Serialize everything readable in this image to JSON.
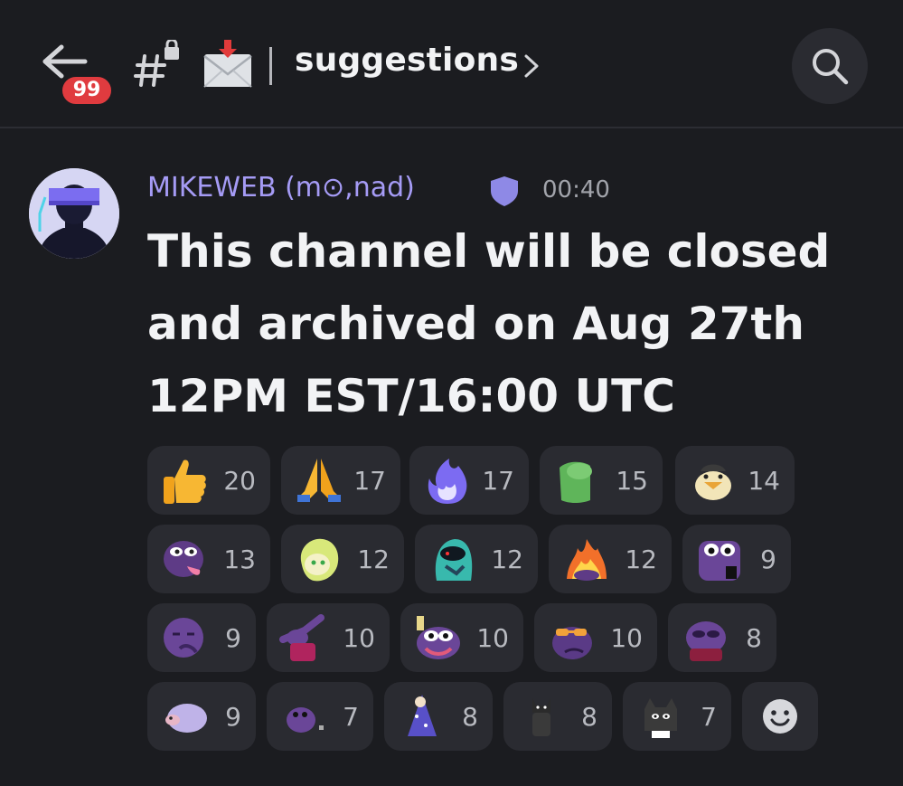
{
  "header": {
    "back_label": "Back",
    "unread_badge": "99",
    "channel_name": "suggestions",
    "channel_chevron": "›"
  },
  "message": {
    "author": "MIKEWEB (m⊙,nad)",
    "timestamp": "00:40",
    "lines": [
      "This channel will be closed",
      "and archived on Aug 27th",
      "12PM EST/16:00 UTC"
    ]
  },
  "reactions": [
    {
      "icon": "thumbs-up-icon",
      "count": "20"
    },
    {
      "icon": "folded-hands-icon",
      "count": "17"
    },
    {
      "icon": "purple-fire-icon",
      "count": "17"
    },
    {
      "icon": "green-creature-icon",
      "count": "15"
    },
    {
      "icon": "duck-icon",
      "count": "14"
    },
    {
      "icon": "pepe-tongue-icon",
      "count": "13"
    },
    {
      "icon": "green-anime-icon",
      "count": "12"
    },
    {
      "icon": "teal-alien-icon",
      "count": "12"
    },
    {
      "icon": "burning-pepe-icon",
      "count": "12"
    },
    {
      "icon": "staring-pepe-icon",
      "count": "9"
    },
    {
      "icon": "facepalm-pepe-icon",
      "count": "9"
    },
    {
      "icon": "dab-pepe-icon",
      "count": "10"
    },
    {
      "icon": "toast-pepe-icon",
      "count": "10"
    },
    {
      "icon": "sunglasses-pepe-icon",
      "count": "10"
    },
    {
      "icon": "sad-pepe-icon",
      "count": "8"
    },
    {
      "icon": "hedgehog-icon",
      "count": "9"
    },
    {
      "icon": "tiny-pepe-icon",
      "count": "7"
    },
    {
      "icon": "wizard-icon",
      "count": "8"
    },
    {
      "icon": "cat-figure-icon",
      "count": "8"
    },
    {
      "icon": "black-cat-icon",
      "count": "7"
    }
  ],
  "colors": {
    "background": "#1b1c20",
    "pill": "#2a2b31",
    "author": "#a59bf5",
    "badge": "#e03b3f"
  }
}
